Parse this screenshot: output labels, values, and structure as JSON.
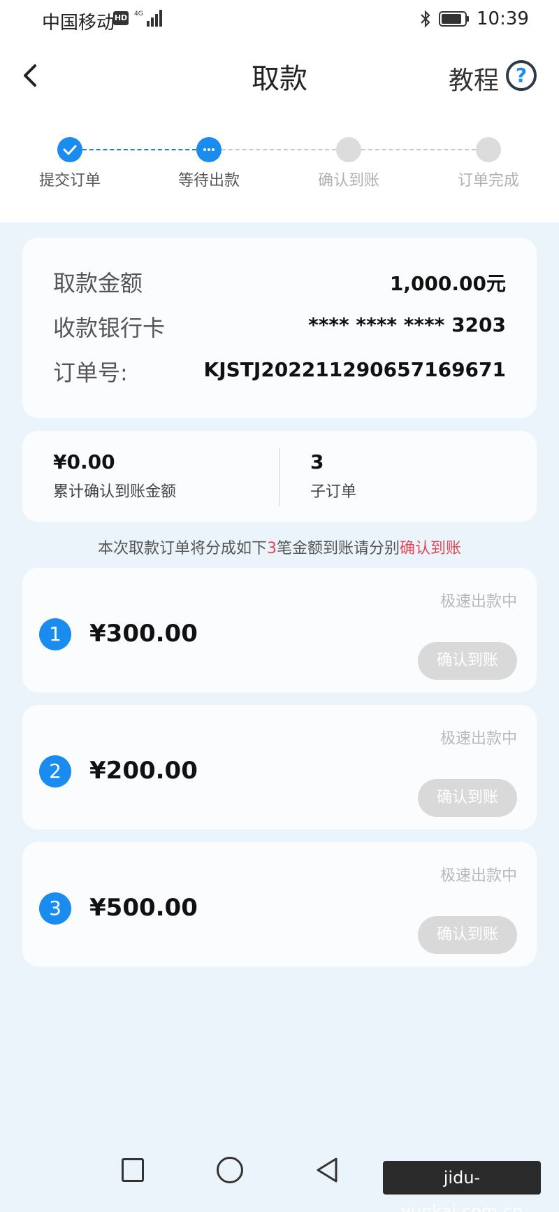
{
  "status_bar": {
    "carrier": "中国移动",
    "network_badge": "HD",
    "network_icon": "signal-4g-icon",
    "bluetooth_icon": "bluetooth-icon",
    "battery_icon": "battery-icon",
    "time": "10:39"
  },
  "header": {
    "back_icon": "chevron-left-icon",
    "title": "取款",
    "help_label": "教程",
    "help_icon": "?"
  },
  "progress": {
    "steps": [
      {
        "label": "提交订单",
        "state": "done"
      },
      {
        "label": "等待出款",
        "state": "current"
      },
      {
        "label": "确认到账",
        "state": "pending"
      },
      {
        "label": "订单完成",
        "state": "pending"
      }
    ]
  },
  "order_info": {
    "amount_label": "取款金额",
    "amount_value": "1,000.00元",
    "card_label": "收款银行卡",
    "card_value": "**** **** **** 3203",
    "order_no_label": "订单号:",
    "order_no_value": "KJSTJ2022112906571696​71"
  },
  "summary": {
    "confirmed_amount": "¥0.00",
    "confirmed_label": "累计确认到账金额",
    "sub_order_count": "3",
    "sub_order_label": "子订单"
  },
  "notice": {
    "prefix": "本次取款订单将分成如下",
    "count": "3",
    "middle": "笔金额到账请分别",
    "action": "确认到账"
  },
  "sub_orders": [
    {
      "index": "1",
      "amount": "¥300.00",
      "status": "极速出款中",
      "button": "确认到账"
    },
    {
      "index": "2",
      "amount": "¥200.00",
      "status": "极速出款中",
      "button": "确认到账"
    },
    {
      "index": "3",
      "amount": "¥500.00",
      "status": "极速出款中",
      "button": "确认到账"
    }
  ],
  "system_nav": {
    "recent_icon": "square-icon",
    "home_icon": "circle-icon",
    "back_icon": "triangle-back-icon"
  },
  "watermark": "jidu-yunkai.com.cn",
  "colors": {
    "accent": "#1a8cf0",
    "highlight": "#e04858",
    "disabled_button": "#d9d9d9",
    "page_background": "#eaf4fa"
  }
}
